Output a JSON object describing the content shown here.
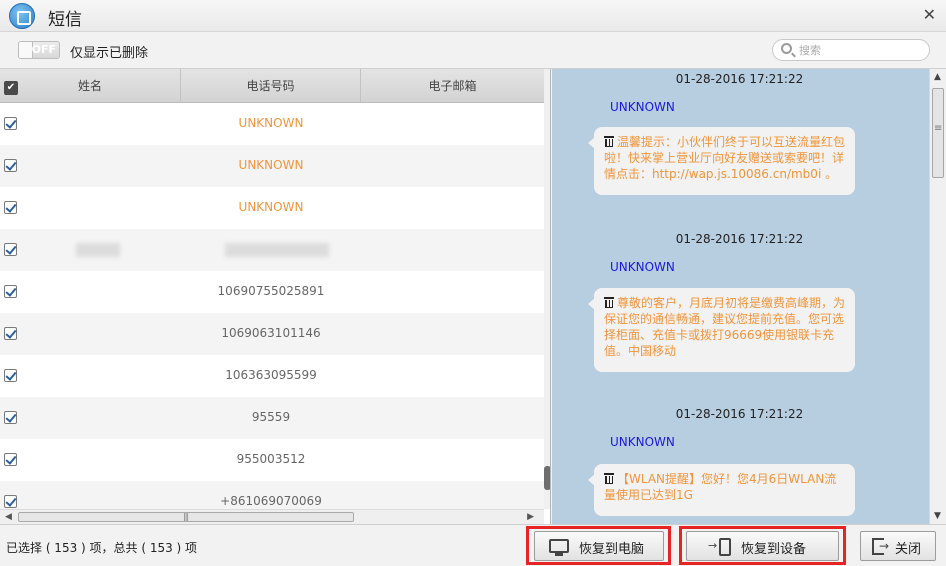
{
  "window": {
    "title": "短信"
  },
  "toolbar": {
    "toggle_state": "OFF",
    "toggle_label": "仅显示已删除",
    "search_placeholder": "搜索"
  },
  "table": {
    "headers": {
      "name": "姓名",
      "phone": "电话号码",
      "email": "电子邮箱"
    },
    "rows": [
      {
        "name": "",
        "phone": "UNKNOWN",
        "checked": true
      },
      {
        "name": "",
        "phone": "UNKNOWN",
        "checked": true
      },
      {
        "name": "",
        "phone": "UNKNOWN",
        "checked": true
      },
      {
        "name": "",
        "phone": "",
        "checked": true
      },
      {
        "name": "",
        "phone": "10690755025891",
        "checked": true
      },
      {
        "name": "",
        "phone": "1069063101146",
        "checked": true
      },
      {
        "name": "",
        "phone": "106363095599",
        "checked": true
      },
      {
        "name": "",
        "phone": "95559",
        "checked": true
      },
      {
        "name": "",
        "phone": "955003512",
        "checked": true
      },
      {
        "name": "",
        "phone": "+861069070069",
        "checked": true
      }
    ]
  },
  "messages": [
    {
      "time": "01-28-2016 17:21:22",
      "sender": "UNKNOWN",
      "text": "温馨提示：小伙伴们终于可以互送流量红包啦！快来掌上营业厅向好友赠送或索要吧！详情点击：http://wap.js.10086.cn/mb0i 。"
    },
    {
      "time": "01-28-2016 17:21:22",
      "sender": "UNKNOWN",
      "text": "尊敬的客户，月底月初将是缴费高峰期，为保证您的通信畅通，建议您提前充值。您可选择柜面、充值卡或拨打96669使用银联卡充值。中国移动"
    },
    {
      "time": "01-28-2016 17:21:22",
      "sender": "UNKNOWN",
      "text": "【WLAN提醒】您好！您4月6日WLAN流量使用已达到1G"
    }
  ],
  "footer": {
    "status": "已选择 ( 153 ) 项，总共 ( 153 ) 项",
    "restore_pc": "恢复到电脑",
    "restore_device": "恢复到设备",
    "close": "关闭"
  },
  "colors": {
    "unknown_orange": "#f0953a",
    "sender_blue": "#1a1ad8",
    "message_bg": "#b7cde0",
    "highlight_red": "#e62424"
  }
}
